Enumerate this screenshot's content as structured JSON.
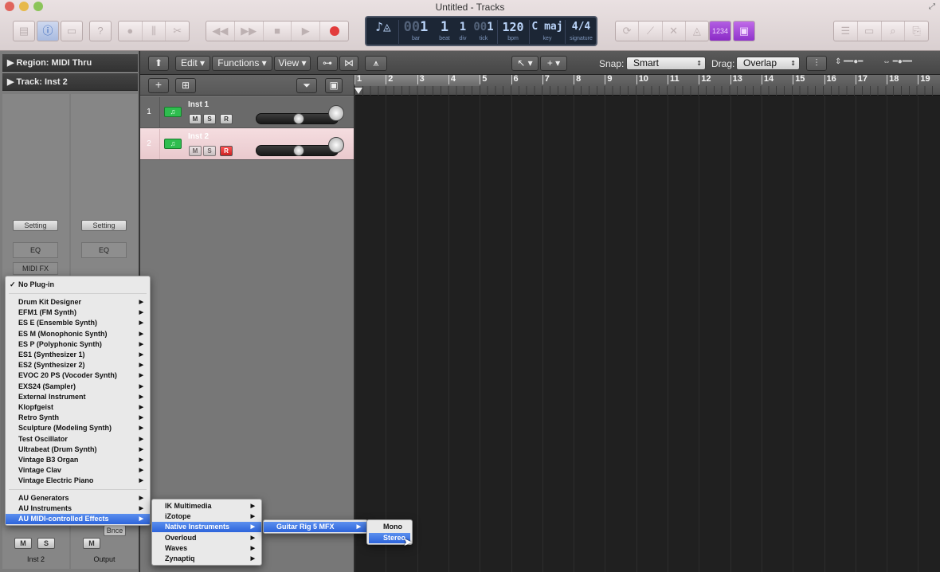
{
  "window": {
    "title": "Untitled - Tracks"
  },
  "lcd": {
    "bar": "1",
    "bar_lead": "00",
    "beat": "1",
    "div": "1",
    "tick": "1",
    "tick_lead": "00",
    "bpm": "120",
    "key": "C maj",
    "signature": "4/4",
    "labels": {
      "bar": "bar",
      "beat": "beat",
      "div": "div",
      "tick": "tick",
      "bpm": "bpm",
      "key": "key",
      "signature": "signature"
    },
    "counter_badge": "1234"
  },
  "inspector": {
    "region": "Region: MIDI Thru",
    "track": "Track: Inst 2",
    "setting_label": "Setting",
    "eq_label": "EQ",
    "midifx_label": "MIDI FX",
    "bounce_label": "Bnce",
    "m_label": "M",
    "s_label": "S",
    "strip1_name": "Inst 2",
    "strip2_name": "Output"
  },
  "arrange_header": {
    "edit": "Edit",
    "functions": "Functions",
    "view": "View",
    "snap_label": "Snap:",
    "snap_value": "Smart",
    "drag_label": "Drag:",
    "drag_value": "Overlap"
  },
  "tracks": [
    {
      "num": "1",
      "name": "Inst 1",
      "m": "M",
      "s": "S",
      "r": "R"
    },
    {
      "num": "2",
      "name": "Inst 2",
      "m": "M",
      "s": "S",
      "r": "R"
    }
  ],
  "ruler": [
    "1",
    "2",
    "3",
    "4",
    "5",
    "6",
    "7",
    "8",
    "9",
    "10",
    "11",
    "12",
    "13",
    "14",
    "15",
    "16",
    "17",
    "18",
    "19"
  ],
  "plugin_menu": {
    "no_plugin": "No Plug-in",
    "items": [
      "Drum Kit Designer",
      "EFM1  (FM Synth)",
      "ES E  (Ensemble Synth)",
      "ES M  (Monophonic Synth)",
      "ES P  (Polyphonic Synth)",
      "ES1  (Synthesizer 1)",
      "ES2  (Synthesizer 2)",
      "EVOC 20 PS  (Vocoder Synth)",
      "EXS24  (Sampler)",
      "External Instrument",
      "Klopfgeist",
      "Retro Synth",
      "Sculpture  (Modeling Synth)",
      "Test Oscillator",
      "Ultrabeat  (Drum Synth)",
      "Vintage B3 Organ",
      "Vintage Clav",
      "Vintage Electric Piano"
    ],
    "au_items": [
      "AU Generators",
      "AU Instruments",
      "AU MIDI-controlled Effects"
    ]
  },
  "vendor_menu": [
    "IK Multimedia",
    "iZotope",
    "Native Instruments",
    "Overloud",
    "Waves",
    "Zynaptiq"
  ],
  "ni_menu": [
    "Guitar Rig 5 MFX"
  ],
  "channel_menu": [
    "Mono",
    "Stereo"
  ]
}
